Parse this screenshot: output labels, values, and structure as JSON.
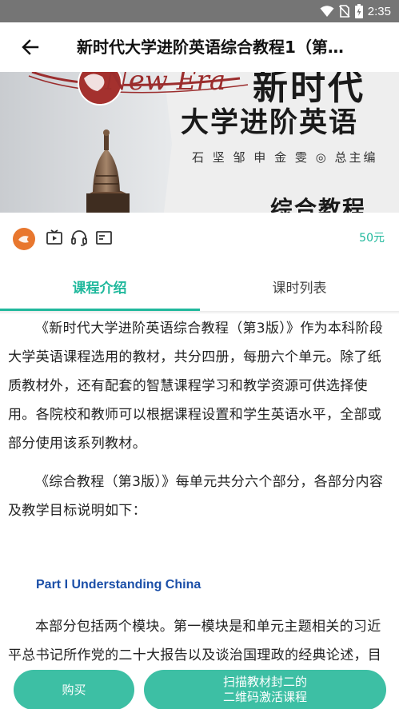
{
  "status_bar": {
    "time": "2:35"
  },
  "header": {
    "title": "新时代大学进阶英语综合教程1（第…"
  },
  "cover": {
    "brand": "New Era",
    "title_line1": "新时代",
    "title_line2": "大学进阶英语",
    "editors": "石 坚  邹 申  金 雯 ◎ 总主编",
    "title_line3": "综合教程"
  },
  "course_info": {
    "price": "50元",
    "icons": [
      "video-icon",
      "headphones-icon",
      "document-icon"
    ]
  },
  "tabs": [
    {
      "label": "课程介绍",
      "active": true
    },
    {
      "label": "课时列表",
      "active": false
    }
  ],
  "content": {
    "paragraphs": [
      "《新时代大学进阶英语综合教程（第3版）》作为本科阶段大学英语课程选用的教材，共分四册，每册六个单元。除了纸质教材外，还有配套的智慧课程学习和教学资源可供选择使用。各院校和教师可以根据课程设置和学生英语水平，全部或部分使用该系列教材。",
      "《综合教程（第3版）》每单元共分六个部分，各部分内容及教学目标说明如下：",
      "本部分包括两个模块。第一模块是和单元主题相关的习近平总书记所作党的二十大报告以及谈治国理政的经典论述，目"
    ],
    "section_title": "Part I Understanding China"
  },
  "bottom_bar": {
    "buy_label": "购买",
    "scan_label_line1": "扫描教材封二的",
    "scan_label_line2": "二维码激活课程"
  },
  "colors": {
    "accent": "#1fb89c",
    "button": "#3dbfa4",
    "section_title": "#1b4fa8",
    "status_bar": "#757575"
  }
}
